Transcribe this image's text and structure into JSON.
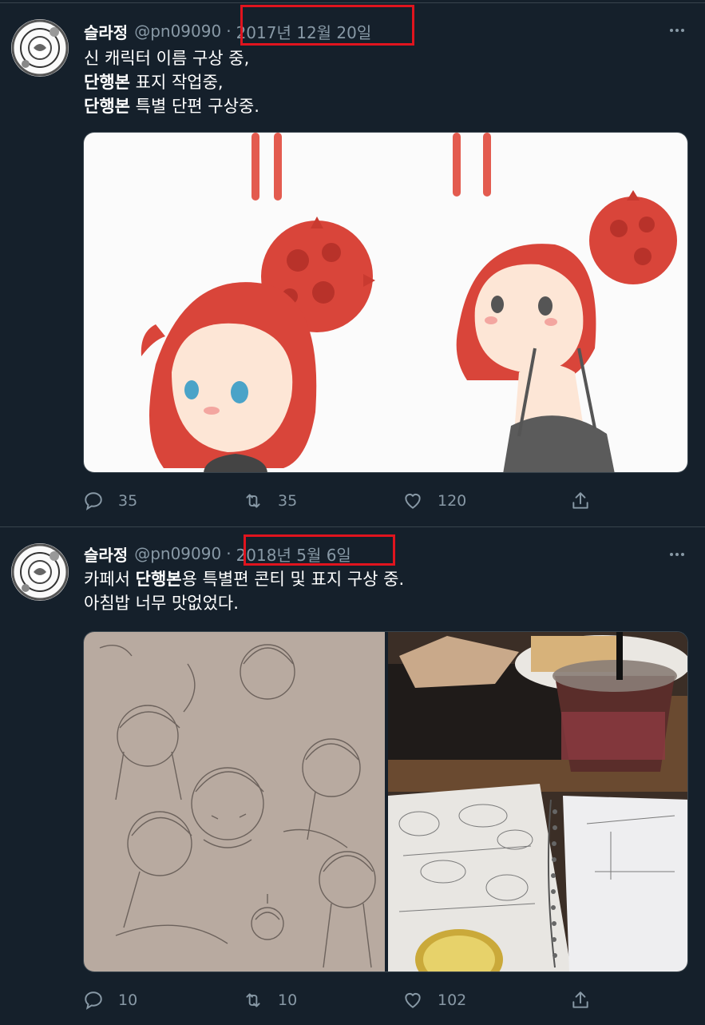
{
  "tweets": [
    {
      "name": "슬라정",
      "handle": "@pn09090",
      "separator": "·",
      "date": "2017년 12월 20일",
      "lines": [
        [
          {
            "t": "신 캐릭터 이름 구상 중,",
            "b": false
          }
        ],
        [
          {
            "t": "단행본",
            "b": true
          },
          {
            "t": " 표지 작업중,",
            "b": false
          }
        ],
        [
          {
            "t": "단행본",
            "b": true
          },
          {
            "t": " 특별 단편 구상중.",
            "b": false
          }
        ]
      ],
      "media_description": "illustration-red-haired-character",
      "reply_count": "35",
      "retweet_count": "35",
      "like_count": "120"
    },
    {
      "name": "슬라정",
      "handle": "@pn09090",
      "separator": "·",
      "date": "2018년 5월 6일",
      "lines": [
        [
          {
            "t": "카페서 ",
            "b": false
          },
          {
            "t": "단행본",
            "b": true
          },
          {
            "t": "용 특별편 콘티 및 표지 구상 중.",
            "b": false
          }
        ],
        [
          {
            "t": "아침밥 너무 맛없었다.",
            "b": false
          }
        ]
      ],
      "media_description": "pencil-sketch-and-cafe-photo",
      "reply_count": "10",
      "retweet_count": "10",
      "like_count": "102"
    }
  ],
  "icons": {
    "reply": "speech-bubble-icon",
    "retweet": "retweet-arrows-icon",
    "like": "heart-icon",
    "share": "share-upload-icon",
    "more": "more-dots-icon"
  },
  "colors": {
    "background": "#15202b",
    "text": "#ffffff",
    "secondary": "#8899a6",
    "divider": "#38444d",
    "highlight_box": "#e0141e",
    "hair_red": "#d9453a"
  }
}
